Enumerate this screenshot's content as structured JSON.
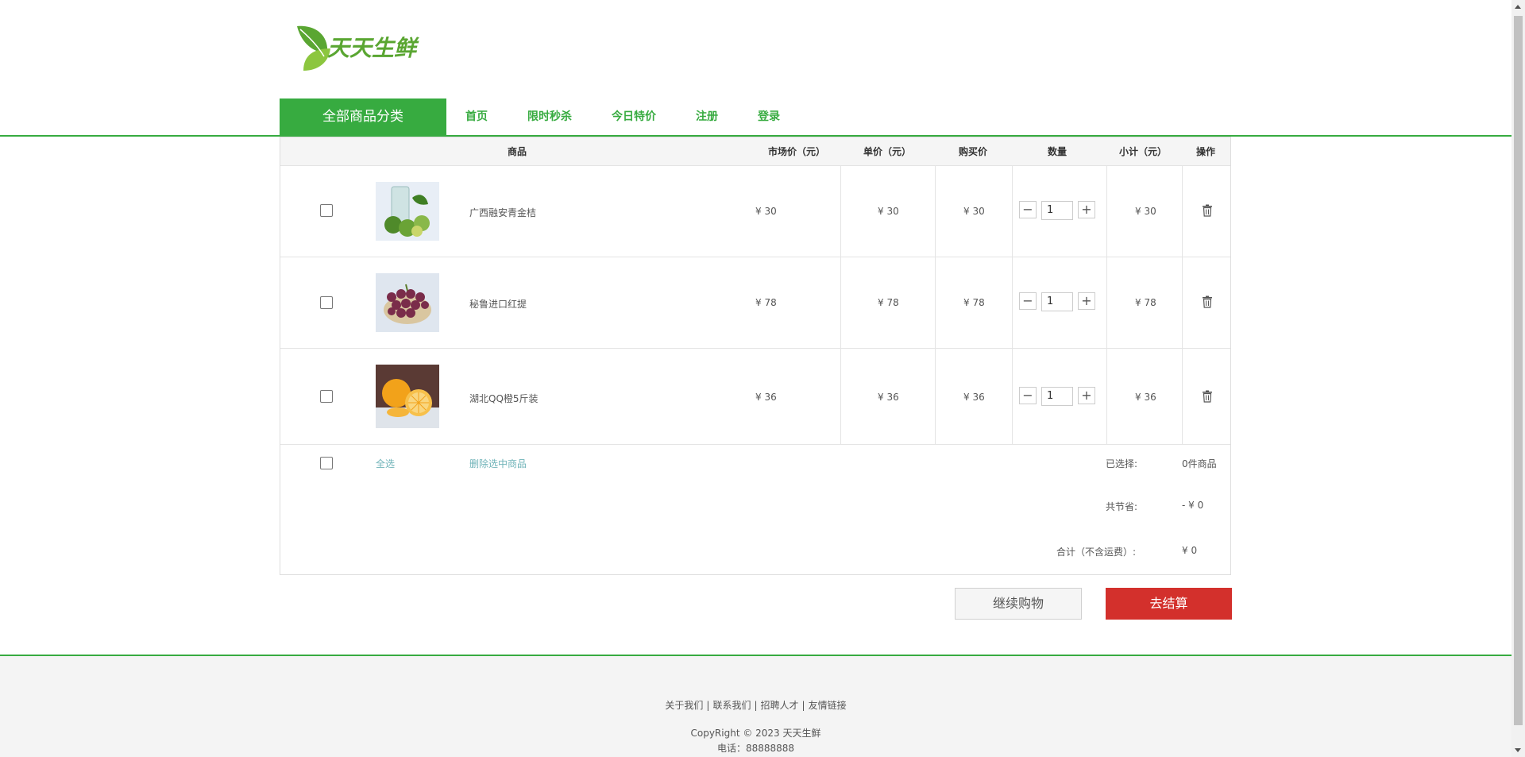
{
  "brand": {
    "name": "天天生鲜",
    "green": "#37ab40",
    "red": "#d3302c"
  },
  "nav": {
    "category": "全部商品分类",
    "links": [
      "首页",
      "限时秒杀",
      "今日特价",
      "注册",
      "登录"
    ]
  },
  "table": {
    "headers": [
      "商品",
      "市场价（元）",
      "单价（元）",
      "购买价",
      "数量",
      "小计（元）",
      "操作"
    ],
    "rows": [
      {
        "name": "广西融安青金桔",
        "market_price": "¥ 30",
        "unit_price": "¥ 30",
        "buy_price": "¥ 30",
        "qty": "1",
        "subtotal": "¥ 30",
        "checked": false,
        "image": "kumquat"
      },
      {
        "name": "秘鲁进口红提",
        "market_price": "¥ 78",
        "unit_price": "¥ 78",
        "buy_price": "¥ 78",
        "qty": "1",
        "subtotal": "¥ 78",
        "checked": false,
        "image": "red-grapes"
      },
      {
        "name": "湖北QQ橙5斤装",
        "market_price": "¥ 36",
        "unit_price": "¥ 36",
        "buy_price": "¥ 36",
        "qty": "1",
        "subtotal": "¥ 36",
        "checked": false,
        "image": "oranges"
      }
    ]
  },
  "summary": {
    "select_all": "全选",
    "delete_selected": "删除选中商品",
    "selected_label": "已选择:",
    "selected_value": "0件商品",
    "saved_label": "共节省:",
    "saved_value": "- ¥ 0",
    "total_label": "合计（不含运费）:",
    "total_value": "¥ 0"
  },
  "buttons": {
    "continue": "继续购物",
    "checkout": "去结算"
  },
  "footer": {
    "links": [
      "关于我们",
      "联系我们",
      "招聘人才",
      "友情链接"
    ],
    "copyright": "CopyRight © 2023 天天生鲜",
    "phone": "电话：88888888"
  }
}
